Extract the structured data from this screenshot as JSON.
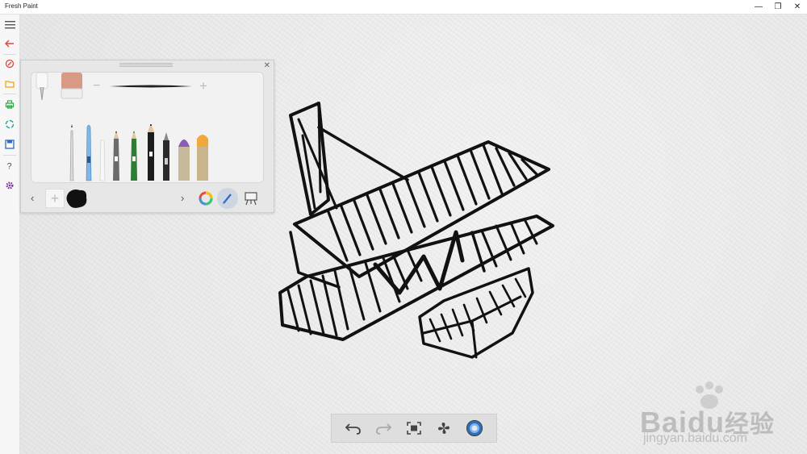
{
  "window": {
    "title": "Fresh Paint",
    "minimize": "—",
    "restore": "❐",
    "close": "✕"
  },
  "rail": {
    "items": [
      {
        "icon": "hamburger-icon"
      },
      {
        "icon": "back-arrow-icon",
        "color": "#e0463c"
      },
      {
        "icon": "brush-icon",
        "color": "#e0463c"
      },
      {
        "icon": "folder-icon",
        "color": "#f1a50d"
      },
      {
        "icon": "print-icon",
        "color": "#3aa64a"
      },
      {
        "icon": "share-icon",
        "color": "#2aa1a1"
      },
      {
        "icon": "save-icon",
        "color": "#2b6cc4"
      },
      {
        "icon": "help-icon",
        "color": "#555555"
      },
      {
        "icon": "settings-icon",
        "color": "#7b2fa3"
      }
    ]
  },
  "panel": {
    "close": "✕",
    "size_minus": "−",
    "size_plus": "+",
    "prev": "‹",
    "next": "›",
    "add_color": "+"
  },
  "bottom_bar": {
    "buttons": [
      "undo-icon",
      "redo-icon",
      "fit-to-screen-icon",
      "fan-icon",
      "paint-dry-icon"
    ]
  },
  "watermark": {
    "brand": "Bai",
    "brand2": "du",
    "cn": "经验",
    "url": "jingyan.baidu.com"
  },
  "colors": {
    "accent_red": "#e0463c",
    "accent_blue": "#2b6cc4"
  }
}
